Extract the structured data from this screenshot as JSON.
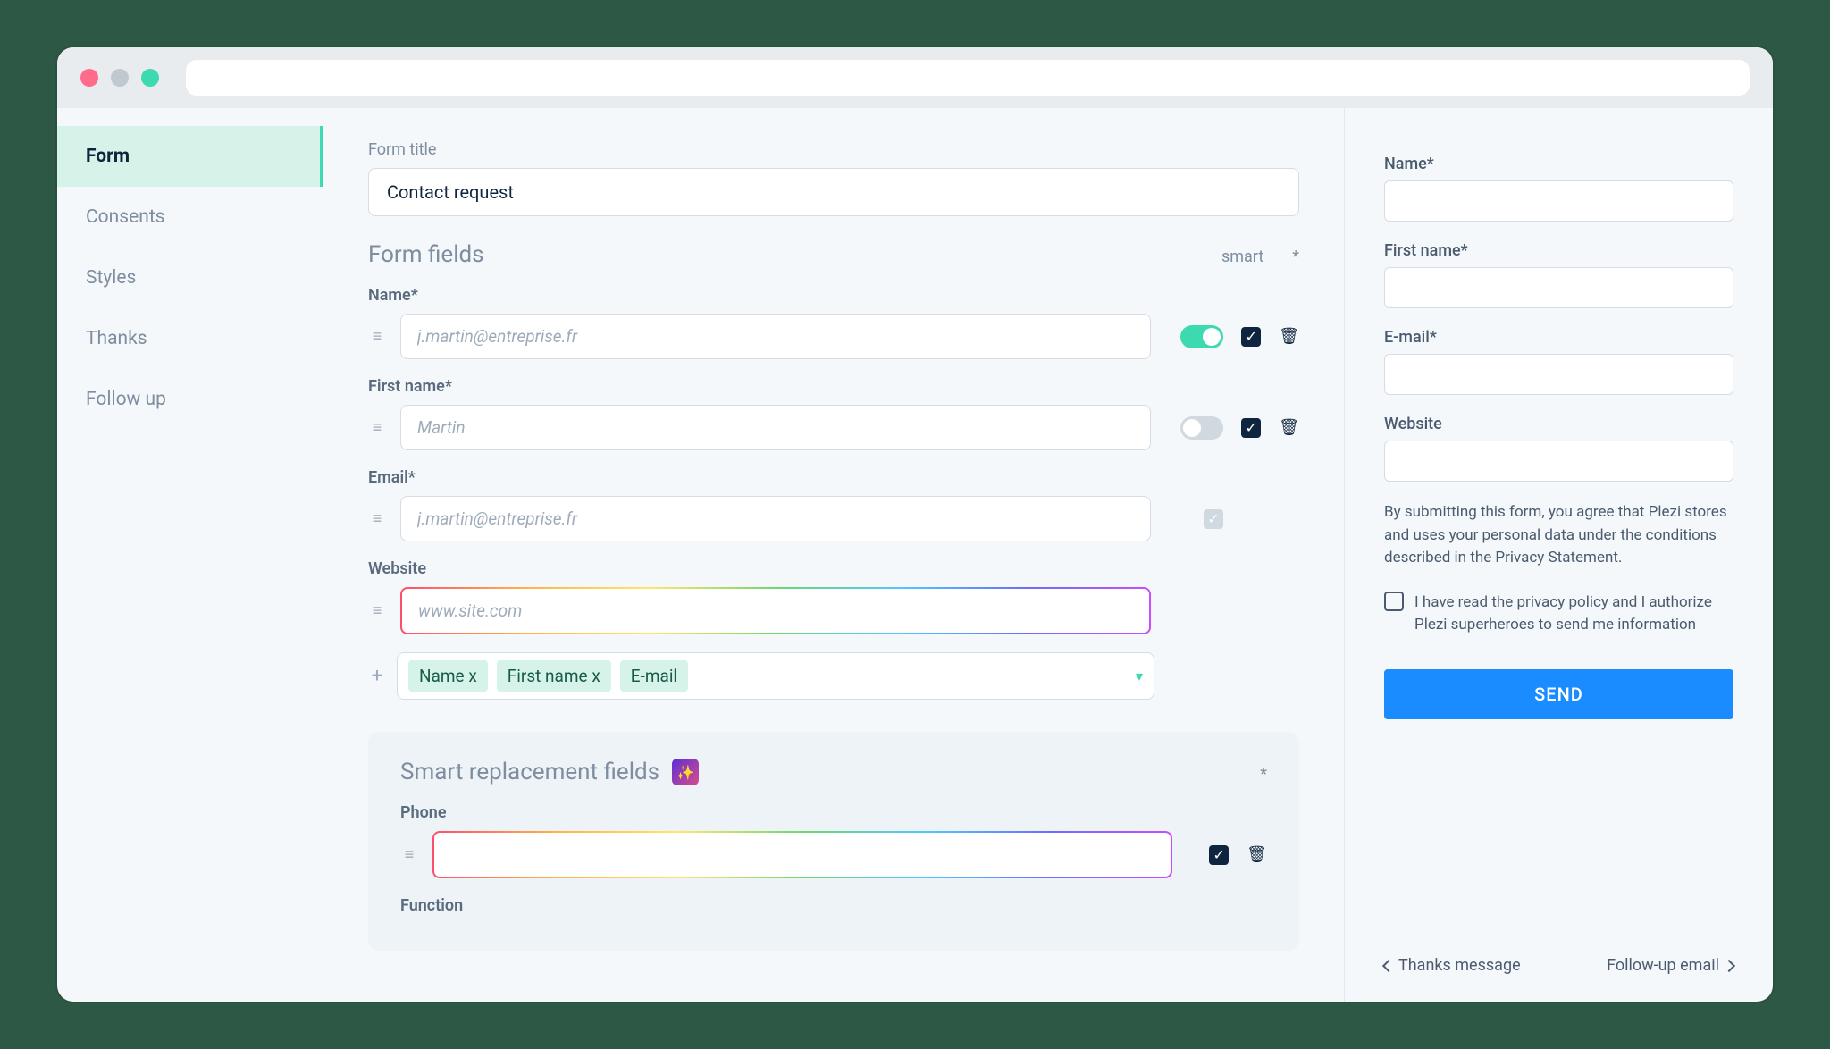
{
  "sidebar": {
    "items": [
      {
        "label": "Form"
      },
      {
        "label": "Consents"
      },
      {
        "label": "Styles"
      },
      {
        "label": "Thanks"
      },
      {
        "label": "Follow up"
      }
    ]
  },
  "main": {
    "form_title_label": "Form title",
    "form_title_value": "Contact request",
    "form_fields_title": "Form fields",
    "smart_label": "smart",
    "star_label": "*",
    "fields": [
      {
        "label": "Name*",
        "placeholder": "j.martin@entreprise.fr",
        "smart": true,
        "required": true,
        "deletable": true
      },
      {
        "label": "First name*",
        "placeholder": "Martin",
        "smart": false,
        "required": true,
        "deletable": true
      },
      {
        "label": "Email*",
        "placeholder": "j.martin@entreprise.fr",
        "smart": null,
        "required": "disabled",
        "deletable": false
      },
      {
        "label": "Website",
        "placeholder": "www.site.com",
        "smart": null,
        "required": null,
        "deletable": false,
        "rainbow": true
      }
    ],
    "tags": [
      "Name x",
      "First name x",
      "E-mail"
    ],
    "smart_panel_title": "Smart replacement fields",
    "smart_fields": [
      {
        "label": "Phone",
        "placeholder": "",
        "required": true,
        "deletable": true,
        "rainbow": true
      },
      {
        "label": "Function",
        "placeholder": "",
        "rainbow": true
      }
    ]
  },
  "preview": {
    "name_label": "Name*",
    "firstname_label": "First name*",
    "email_label": "E-mail*",
    "website_label": "Website",
    "disclaimer": "By submitting this form, you agree that Plezi stores and uses your personal data under the conditions described in the Privacy Statement.",
    "consent": "I have read the privacy policy and I authorize Plezi superheroes to send me information",
    "send_label": "SEND",
    "prev_label": "Thanks message",
    "next_label": "Follow-up email"
  }
}
